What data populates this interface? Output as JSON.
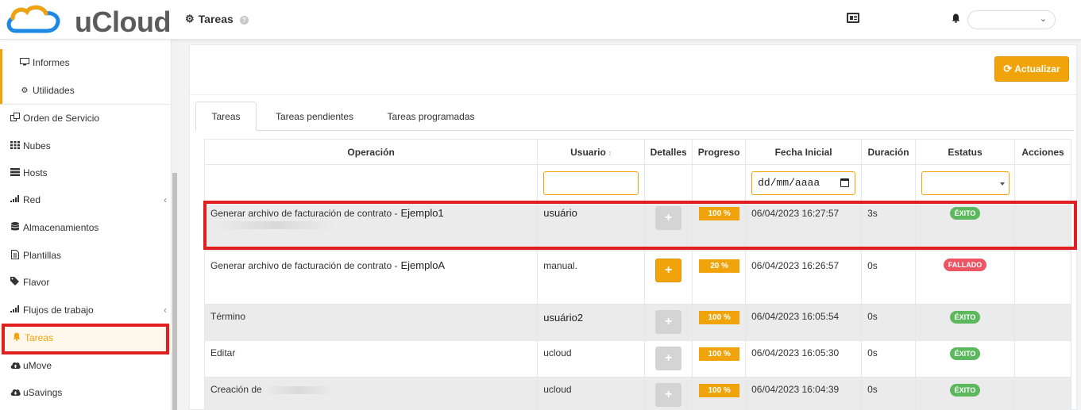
{
  "app": {
    "logo_text": "uCloud",
    "page_title": "Tareas",
    "accent_color": "#f0a30a"
  },
  "header": {
    "help_icon": "question-circle-icon",
    "card_icon": "id-card-icon",
    "bell_icon": "bell-icon",
    "user_select_value": "",
    "user_select_icon": "chevron-down-icon"
  },
  "sidebar": {
    "items": [
      {
        "label": "Informes",
        "icon": "monitor-icon"
      },
      {
        "label": "Utilidades",
        "icon": "cogs-icon"
      },
      {
        "label": "Orden de Servicio",
        "icon": "windows-icon"
      },
      {
        "label": "Nubes",
        "icon": "grid-icon"
      },
      {
        "label": "Hosts",
        "icon": "server-icon"
      },
      {
        "label": "Red",
        "icon": "signal-icon",
        "caret": "‹"
      },
      {
        "label": "Almacenamientos",
        "icon": "database-icon"
      },
      {
        "label": "Plantillas",
        "icon": "file-icon"
      },
      {
        "label": "Flavor",
        "icon": "tag-icon"
      },
      {
        "label": "Flujos de trabajo",
        "icon": "signal-icon",
        "caret": "‹"
      },
      {
        "label": "Tareas",
        "icon": "bell-icon",
        "active": true
      },
      {
        "label": "uMove",
        "icon": "cloud-upload-icon"
      },
      {
        "label": "uSavings",
        "icon": "cloud-download-icon"
      }
    ]
  },
  "toolbar": {
    "refresh_label": "Actualizar",
    "refresh_icon": "refresh-icon"
  },
  "tabs": [
    {
      "label": "Tareas",
      "active": true
    },
    {
      "label": "Tareas pendientes"
    },
    {
      "label": "Tareas programadas"
    }
  ],
  "table": {
    "headers": {
      "operacion": "Operación",
      "usuario": "Usuario",
      "usuario_sort": "↕",
      "detalles": "Detalles",
      "progreso": "Progreso",
      "fecha": "Fecha Inicial",
      "duracion": "Duración",
      "estatus": "Estatus",
      "acciones": "Acciones"
    },
    "filters": {
      "usuario_value": "",
      "fecha_placeholder": "dd/mm/aaaa",
      "estatus_value": ""
    },
    "rows": [
      {
        "operation": "Generar archivo de facturación de contrato -",
        "operation_name": "Ejemplo1",
        "user": "usuário",
        "details_enabled": false,
        "details_icon": "plus-icon",
        "progress": "100 %",
        "date": "06/04/2023 16:27:57",
        "duration": "3s",
        "status": "ÉXITO",
        "status_color": "#5cb85c"
      },
      {
        "operation": "Generar archivo de facturación de contrato -",
        "operation_name": "EjemploA",
        "user": "manual.",
        "details_enabled": true,
        "details_icon": "plus-icon",
        "progress": "20 %",
        "date": "06/04/2023 16:26:57",
        "duration": "0s",
        "status": "FALLADO",
        "status_color": "#ed5565"
      },
      {
        "operation": "Término",
        "operation_name": "",
        "user": "usuário2",
        "details_enabled": false,
        "details_icon": "plus-icon",
        "progress": "100 %",
        "date": "06/04/2023 16:05:54",
        "duration": "0s",
        "status": "ÉXITO",
        "status_color": "#5cb85c"
      },
      {
        "operation": "Editar",
        "operation_name": "",
        "user": "ucloud",
        "details_enabled": false,
        "details_icon": "plus-icon",
        "progress": "100 %",
        "date": "06/04/2023 16:05:30",
        "duration": "0s",
        "status": "ÉXITO",
        "status_color": "#5cb85c"
      },
      {
        "operation": "Creación de",
        "operation_name": "",
        "user": "ucloud",
        "details_enabled": false,
        "details_icon": "plus-icon",
        "progress": "100 %",
        "date": "06/04/2023 16:04:39",
        "duration": "0s",
        "status": "ÉXITO",
        "status_color": "#5cb85c"
      }
    ]
  }
}
